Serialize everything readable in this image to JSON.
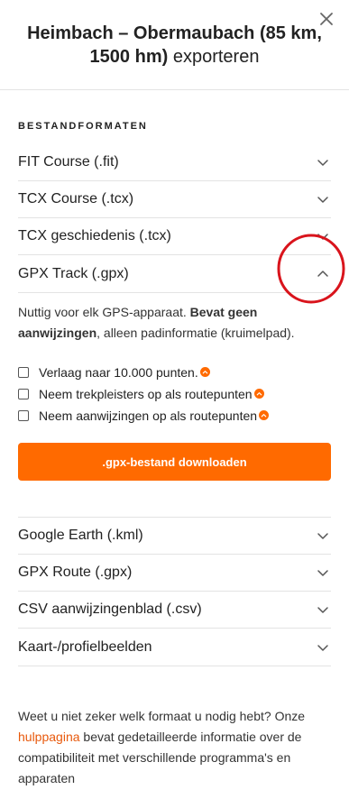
{
  "modal": {
    "title_bold": "Heimbach – Obermaubach (85 km, 1500 hm)",
    "title_rest": "exporteren",
    "close_icon": "close-icon"
  },
  "section": {
    "label": "BESTANDFORMATEN"
  },
  "formats_top": [
    {
      "label": "FIT Course (.fit)",
      "icon": "chevron-down-icon"
    },
    {
      "label": "TCX Course (.tcx)",
      "icon": "chevron-down-icon"
    },
    {
      "label": "TCX geschiedenis (.tcx)",
      "icon": "chevron-down-icon"
    }
  ],
  "gpx_track": {
    "label": "GPX Track (.gpx)",
    "icon": "chevron-up-icon",
    "desc_pre": "Nuttig voor elk GPS-apparaat.",
    "desc_bold": "Bevat geen aanwijzingen",
    "desc_post": ", alleen padinformatie (kruimelpad).",
    "options": [
      {
        "label": "Verlaag naar 10.000 punten.",
        "checked": false
      },
      {
        "label": "Neem trekpleisters op als routepunten",
        "checked": false
      },
      {
        "label": "Neem aanwijzingen op als routepunten",
        "checked": false
      }
    ],
    "download_label": ".gpx-bestand downloaden"
  },
  "formats_bottom": [
    {
      "label": "Google Earth (.kml)",
      "icon": "chevron-down-icon"
    },
    {
      "label": "GPX Route (.gpx)",
      "icon": "chevron-down-icon"
    },
    {
      "label": "CSV aanwijzingenblad (.csv)",
      "icon": "chevron-down-icon"
    },
    {
      "label": "Kaart-/profielbeelden",
      "icon": "chevron-down-icon"
    }
  ],
  "footer": {
    "text_pre": "Weet u niet zeker welk formaat u nodig hebt? Onze",
    "link": "hulppagina",
    "text_post": "bevat gedetailleerde informatie over de compatibiliteit met verschillende programma's en apparaten"
  },
  "colors": {
    "accent": "#ff6a00",
    "link": "#e8590c",
    "annotation": "#d9141c",
    "divider": "#e3e3e3"
  }
}
